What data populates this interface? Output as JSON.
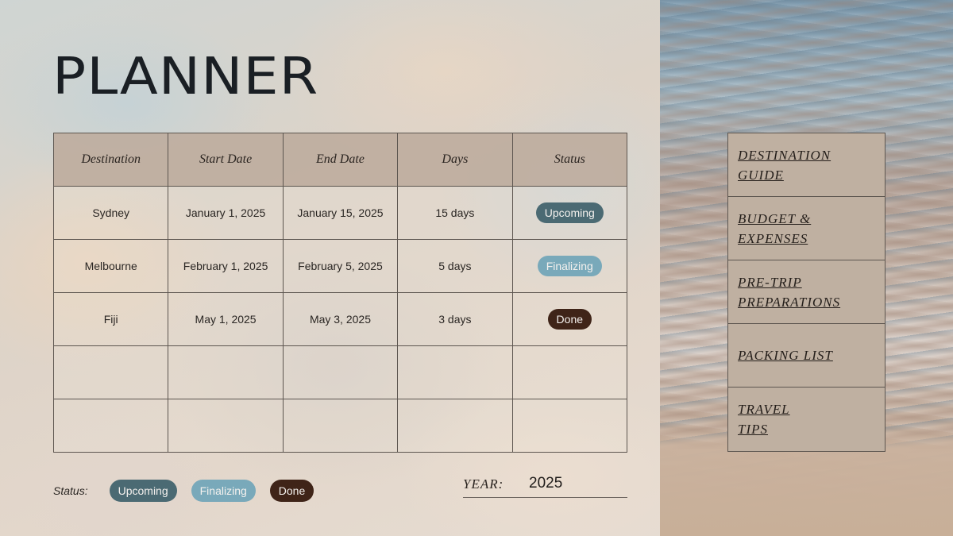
{
  "title": "PLANNER",
  "table": {
    "headers": [
      "Destination",
      "Start Date",
      "End Date",
      "Days",
      "Status"
    ],
    "rows": [
      {
        "destination": "Sydney",
        "start": "January 1, 2025",
        "end": "January 15, 2025",
        "days": "15 days",
        "status": "Upcoming",
        "status_key": "upcoming"
      },
      {
        "destination": "Melbourne",
        "start": "February 1, 2025",
        "end": "February 5, 2025",
        "days": "5 days",
        "status": "Finalizing",
        "status_key": "finalizing"
      },
      {
        "destination": "Fiji",
        "start": "May 1, 2025",
        "end": "May 3, 2025",
        "days": "3 days",
        "status": "Done",
        "status_key": "done"
      },
      {
        "destination": "",
        "start": "",
        "end": "",
        "days": "",
        "status": "",
        "status_key": ""
      },
      {
        "destination": "",
        "start": "",
        "end": "",
        "days": "",
        "status": "",
        "status_key": ""
      }
    ]
  },
  "legend": {
    "label": "Status:",
    "items": [
      {
        "label": "Upcoming",
        "key": "upcoming",
        "color": "#4b6a73"
      },
      {
        "label": "Finalizing",
        "key": "finalizing",
        "color": "#79a9ba"
      },
      {
        "label": "Done",
        "key": "done",
        "color": "#3f2418"
      }
    ]
  },
  "year": {
    "label": "YEAR:",
    "value": "2025"
  },
  "nav": {
    "items": [
      {
        "label": "DESTINATION\nGUIDE"
      },
      {
        "label": "BUDGET &\nEXPENSES"
      },
      {
        "label": "PRE-TRIP\nPREPARATIONS"
      },
      {
        "label": "PACKING LIST"
      },
      {
        "label": "TRAVEL\nTIPS"
      }
    ]
  },
  "colors": {
    "header_bg": "#bfb0a1",
    "upcoming": "#4b6a73",
    "finalizing": "#79a9ba",
    "done": "#3f2418"
  }
}
